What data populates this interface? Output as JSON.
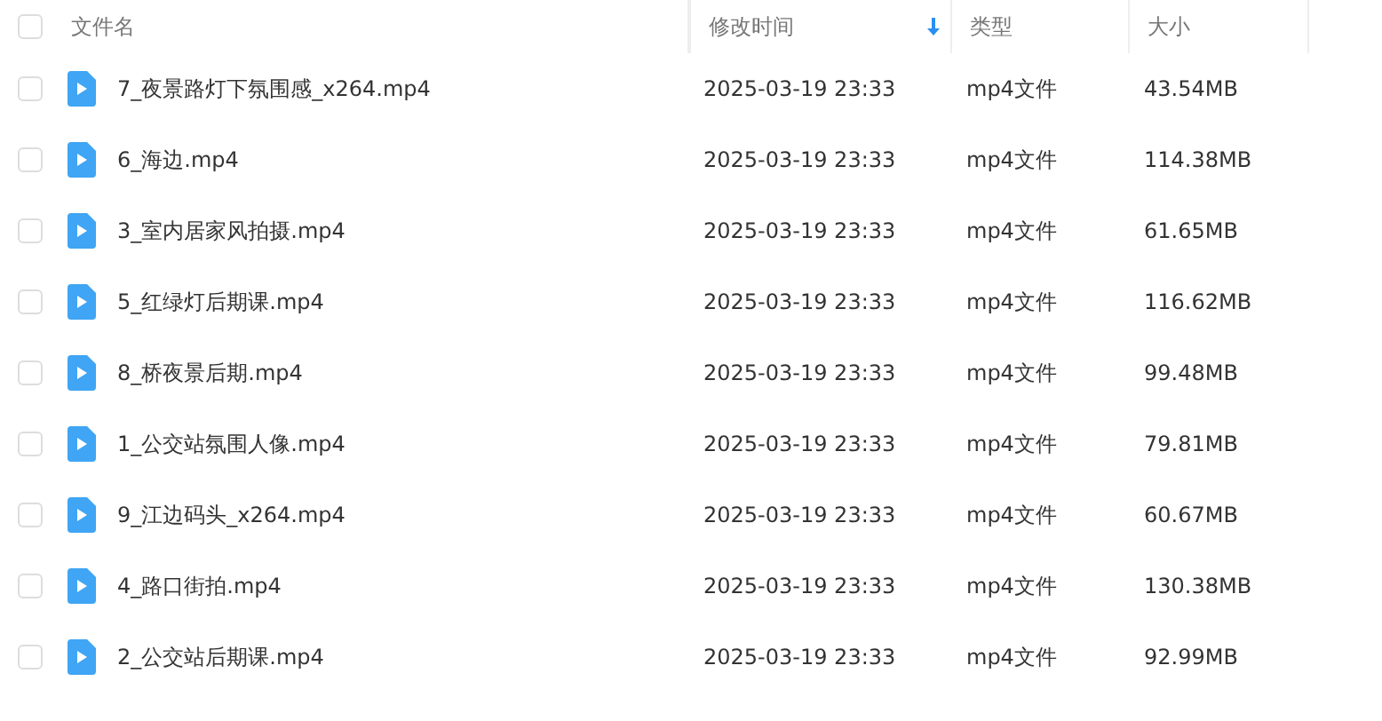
{
  "header": {
    "checked": false,
    "columns": [
      {
        "label": "文件名",
        "sorted": false
      },
      {
        "label": "修改时间",
        "sorted": true
      },
      {
        "label": "类型",
        "sorted": false
      },
      {
        "label": "大小",
        "sorted": false
      }
    ]
  },
  "rows": [
    {
      "checked": false,
      "name": "7_夜景路灯下氛围感_x264.mp4",
      "modified": "2025-03-19 23:33",
      "type": "mp4文件",
      "size": "43.54MB"
    },
    {
      "checked": false,
      "name": "6_海边.mp4",
      "modified": "2025-03-19 23:33",
      "type": "mp4文件",
      "size": "114.38MB"
    },
    {
      "checked": false,
      "name": "3_室内居家风拍摄.mp4",
      "modified": "2025-03-19 23:33",
      "type": "mp4文件",
      "size": "61.65MB"
    },
    {
      "checked": false,
      "name": "5_红绿灯后期课.mp4",
      "modified": "2025-03-19 23:33",
      "type": "mp4文件",
      "size": "116.62MB"
    },
    {
      "checked": false,
      "name": "8_桥夜景后期.mp4",
      "modified": "2025-03-19 23:33",
      "type": "mp4文件",
      "size": "99.48MB"
    },
    {
      "checked": false,
      "name": "1_公交站氛围人像.mp4",
      "modified": "2025-03-19 23:33",
      "type": "mp4文件",
      "size": "79.81MB"
    },
    {
      "checked": false,
      "name": "9_江边码头_x264.mp4",
      "modified": "2025-03-19 23:33",
      "type": "mp4文件",
      "size": "60.67MB"
    },
    {
      "checked": false,
      "name": "4_路口街拍.mp4",
      "modified": "2025-03-19 23:33",
      "type": "mp4文件",
      "size": "130.38MB"
    },
    {
      "checked": false,
      "name": "2_公交站后期课.mp4",
      "modified": "2025-03-19 23:33",
      "type": "mp4文件",
      "size": "92.99MB"
    }
  ]
}
